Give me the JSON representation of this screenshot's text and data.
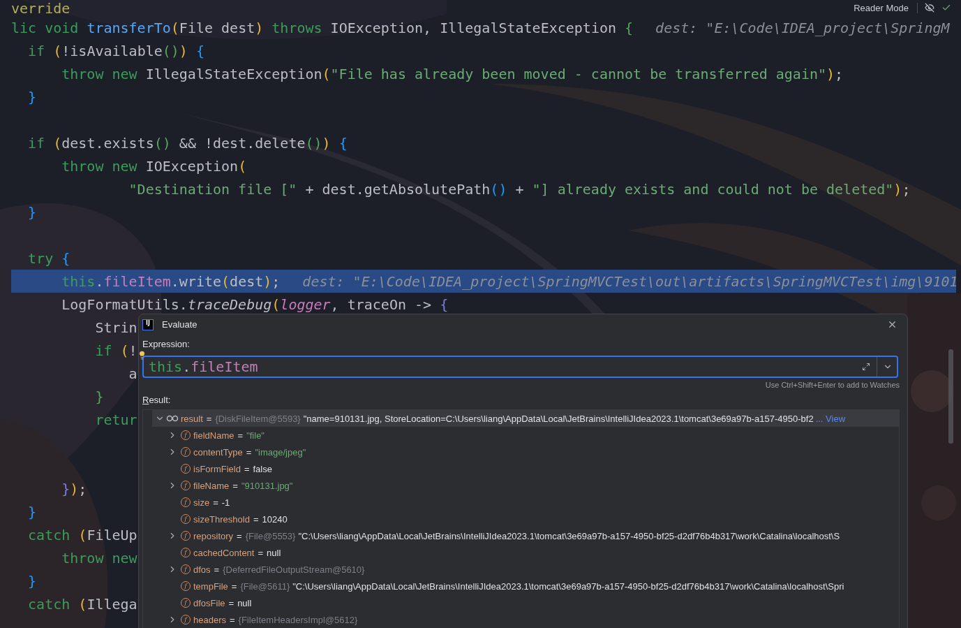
{
  "top_bar": {
    "reader_mode": "Reader Mode"
  },
  "code_lines": [
    {
      "kind": "code",
      "highlighted": false,
      "tokens": [
        {
          "kind": "annot",
          "text": "verride"
        }
      ]
    },
    {
      "kind": "code",
      "highlighted": false,
      "tokens": [
        {
          "kind": "kw",
          "text": "lic void "
        },
        {
          "kind": "fn",
          "text": "transferTo"
        },
        {
          "kind": "p1",
          "text": "("
        },
        {
          "kind": "plain",
          "text": "File dest"
        },
        {
          "kind": "p1",
          "text": ")"
        },
        {
          "kind": "kw",
          "text": " throws"
        },
        {
          "kind": "plain",
          "text": " IOException, IllegalStateException "
        },
        {
          "kind": "p2",
          "text": "{"
        }
      ],
      "hint": "dest: \"E:\\Code\\IDEA_project\\SpringM"
    },
    {
      "kind": "code",
      "highlighted": false,
      "tokens": [
        {
          "kind": "kw",
          "text": "  if"
        },
        {
          "kind": "p1",
          "text": " ("
        },
        {
          "kind": "plain",
          "text": "!isAvailable"
        },
        {
          "kind": "p2",
          "text": "()"
        },
        {
          "kind": "p1",
          "text": ")"
        },
        {
          "kind": "p3",
          "text": " {"
        }
      ]
    },
    {
      "kind": "code",
      "highlighted": false,
      "tokens": [
        {
          "kind": "kw",
          "text": "      throw new"
        },
        {
          "kind": "plain",
          "text": " IllegalStateException"
        },
        {
          "kind": "p1",
          "text": "("
        },
        {
          "kind": "str",
          "text": "\"File has already been moved - cannot be transferred again\""
        },
        {
          "kind": "p1",
          "text": ")"
        },
        {
          "kind": "plain",
          "text": ";"
        }
      ]
    },
    {
      "kind": "code",
      "highlighted": false,
      "tokens": [
        {
          "kind": "p3",
          "text": "  }"
        }
      ]
    },
    {
      "kind": "blank",
      "highlighted": false
    },
    {
      "kind": "code",
      "highlighted": false,
      "tokens": [
        {
          "kind": "kw",
          "text": "  if"
        },
        {
          "kind": "p1",
          "text": " ("
        },
        {
          "kind": "plain",
          "text": "dest.exists"
        },
        {
          "kind": "p2",
          "text": "()"
        },
        {
          "kind": "plain",
          "text": " && !dest.delete"
        },
        {
          "kind": "p2",
          "text": "()"
        },
        {
          "kind": "p1",
          "text": ")"
        },
        {
          "kind": "p3",
          "text": " {"
        }
      ]
    },
    {
      "kind": "code",
      "highlighted": false,
      "tokens": [
        {
          "kind": "kw",
          "text": "      throw new"
        },
        {
          "kind": "plain",
          "text": " IOException"
        },
        {
          "kind": "p1",
          "text": "("
        }
      ]
    },
    {
      "kind": "code",
      "highlighted": false,
      "tokens": [
        {
          "kind": "str",
          "text": "              \"Destination file [\""
        },
        {
          "kind": "plain",
          "text": " + dest.getAbsolutePath"
        },
        {
          "kind": "p3",
          "text": "()"
        },
        {
          "kind": "plain",
          "text": " + "
        },
        {
          "kind": "str",
          "text": "\"] already exists and could not be deleted\""
        },
        {
          "kind": "p1",
          "text": ")"
        },
        {
          "kind": "plain",
          "text": ";"
        }
      ]
    },
    {
      "kind": "code",
      "highlighted": false,
      "tokens": [
        {
          "kind": "p3",
          "text": "  }"
        }
      ]
    },
    {
      "kind": "blank",
      "highlighted": false
    },
    {
      "kind": "code",
      "highlighted": false,
      "tokens": [
        {
          "kind": "kw",
          "text": "  try"
        },
        {
          "kind": "p3",
          "text": " {"
        }
      ]
    },
    {
      "kind": "code",
      "highlighted": true,
      "tokens": [
        {
          "kind": "kw",
          "text": "      this"
        },
        {
          "kind": "plain",
          "text": "."
        },
        {
          "kind": "field",
          "text": "fileItem"
        },
        {
          "kind": "plain",
          "text": ".write"
        },
        {
          "kind": "p1",
          "text": "("
        },
        {
          "kind": "plain",
          "text": "dest"
        },
        {
          "kind": "p1",
          "text": ")"
        },
        {
          "kind": "plain",
          "text": ";"
        }
      ],
      "hint": "dest: \"E:\\Code\\IDEA_project\\SpringMVCTest\\out\\artifacts\\SpringMVCTest\\img\\9101"
    },
    {
      "kind": "code",
      "highlighted": false,
      "tokens": [
        {
          "kind": "plain",
          "text": "      LogFormatUtils."
        },
        {
          "kind": "italic",
          "text": "traceDebug"
        },
        {
          "kind": "p1",
          "text": "("
        },
        {
          "kind": "field_italic",
          "text": "logger"
        },
        {
          "kind": "plain",
          "text": ", traceOn ->"
        },
        {
          "kind": "p4",
          "text": " {"
        }
      ]
    },
    {
      "kind": "code",
      "highlighted": false,
      "tokens": [
        {
          "kind": "plain",
          "text": "          Strin"
        }
      ]
    },
    {
      "kind": "code",
      "highlighted": false,
      "tokens": [
        {
          "kind": "kw",
          "text": "          if"
        },
        {
          "kind": "p1",
          "text": " ("
        },
        {
          "kind": "plain",
          "text": "!"
        }
      ]
    },
    {
      "kind": "code",
      "highlighted": false,
      "tokens": [
        {
          "kind": "plain",
          "text": "              a"
        }
      ]
    },
    {
      "kind": "code",
      "highlighted": false,
      "tokens": [
        {
          "kind": "p2",
          "text": "          }"
        }
      ]
    },
    {
      "kind": "code",
      "highlighted": false,
      "tokens": [
        {
          "kind": "kw",
          "text": "          retur"
        }
      ]
    },
    {
      "kind": "blank",
      "highlighted": false
    },
    {
      "kind": "blank",
      "highlighted": false
    },
    {
      "kind": "code",
      "highlighted": false,
      "tokens": [
        {
          "kind": "p4",
          "text": "      }"
        },
        {
          "kind": "p1",
          "text": ")"
        },
        {
          "kind": "plain",
          "text": ";"
        }
      ]
    },
    {
      "kind": "code",
      "highlighted": false,
      "tokens": [
        {
          "kind": "p3",
          "text": "  }"
        }
      ]
    },
    {
      "kind": "code",
      "highlighted": false,
      "tokens": [
        {
          "kind": "kw",
          "text": "  catch"
        },
        {
          "kind": "p1",
          "text": " ("
        },
        {
          "kind": "plain",
          "text": "FileUp"
        }
      ]
    },
    {
      "kind": "code",
      "highlighted": false,
      "tokens": [
        {
          "kind": "kw",
          "text": "      throw new"
        }
      ]
    },
    {
      "kind": "code",
      "highlighted": false,
      "tokens": [
        {
          "kind": "p3",
          "text": "  }"
        }
      ]
    },
    {
      "kind": "code",
      "highlighted": false,
      "tokens": [
        {
          "kind": "kw",
          "text": "  catch"
        },
        {
          "kind": "p1",
          "text": " ("
        },
        {
          "kind": "plain",
          "text": "Illega"
        }
      ]
    }
  ],
  "dialog": {
    "icon_text": "IJ",
    "title": "Evaluate",
    "expression_label": "Expression:",
    "expression": [
      {
        "kind": "kw",
        "text": "this"
      },
      {
        "kind": "plain",
        "text": "."
      },
      {
        "kind": "field",
        "text": "fileItem"
      }
    ],
    "watch_hint": "Use Ctrl+Shift+Enter to add to Watches",
    "result_label": "Result:",
    "result": {
      "name": "result",
      "sign": "=",
      "ref": "{DiskFileItem@5593}",
      "value": {
        "kind": "plain",
        "text": "\"name=910131.jpg, StoreLocation=C:\\Users\\liang\\AppData\\Local\\JetBrains\\IntelliJIdea2023.1\\tomcat\\3e69a97b-a157-4950-bf2"
      },
      "more": "...",
      "link": "View",
      "expanded": true,
      "selected": true,
      "children": [
        {
          "badge": "f",
          "name": "fieldName",
          "sign": "=",
          "value": {
            "kind": "string",
            "text": "\"file\""
          },
          "expandable": true,
          "selected": false
        },
        {
          "badge": "f",
          "name": "contentType",
          "sign": "=",
          "value": {
            "kind": "string",
            "text": "\"image/jpeg\""
          },
          "expandable": true,
          "selected": false
        },
        {
          "badge": "f",
          "name": "isFormField",
          "sign": "=",
          "value": {
            "kind": "plain",
            "text": "false"
          },
          "expandable": false,
          "selected": false
        },
        {
          "badge": "f",
          "name": "fileName",
          "sign": "=",
          "value": {
            "kind": "string",
            "text": "\"910131.jpg\""
          },
          "expandable": true,
          "selected": false
        },
        {
          "badge": "f",
          "name": "size",
          "sign": "=",
          "value": {
            "kind": "plain",
            "text": "-1"
          },
          "expandable": false,
          "selected": false
        },
        {
          "badge": "f",
          "name": "sizeThreshold",
          "sign": "=",
          "value": {
            "kind": "plain",
            "text": "10240"
          },
          "expandable": false,
          "selected": false
        },
        {
          "badge": "f",
          "name": "repository",
          "sign": "=",
          "ref": "{File@5553}",
          "value": {
            "kind": "plain",
            "text": "\"C:\\Users\\liang\\AppData\\Local\\JetBrains\\IntelliJIdea2023.1\\tomcat\\3e69a97b-a157-4950-bf25-d2df76b4b317\\work\\Catalina\\localhost\\S"
          },
          "expandable": true,
          "selected": false
        },
        {
          "badge": "f",
          "name": "cachedContent",
          "sign": "=",
          "value": {
            "kind": "plain",
            "text": "null"
          },
          "expandable": false,
          "selected": false
        },
        {
          "badge": "f",
          "name": "dfos",
          "sign": "=",
          "ref": "{DeferredFileOutputStream@5610}",
          "expandable": true,
          "selected": false
        },
        {
          "badge": "f",
          "name": "tempFile",
          "sign": "=",
          "ref": "{File@5611}",
          "value": {
            "kind": "plain",
            "text": "\"C:\\Users\\liang\\AppData\\Local\\JetBrains\\IntelliJIdea2023.1\\tomcat\\3e69a97b-a157-4950-bf25-d2df76b4b317\\work\\Catalina\\localhost\\Spri"
          },
          "expandable": false,
          "selected": false
        },
        {
          "badge": "f",
          "name": "dfosFile",
          "sign": "=",
          "value": {
            "kind": "plain",
            "text": "null"
          },
          "expandable": false,
          "selected": false
        },
        {
          "badge": "f",
          "name": "headers",
          "sign": "=",
          "ref": "{FileItemHeadersImpl@5612}",
          "expandable": true,
          "selected": false
        }
      ]
    }
  }
}
